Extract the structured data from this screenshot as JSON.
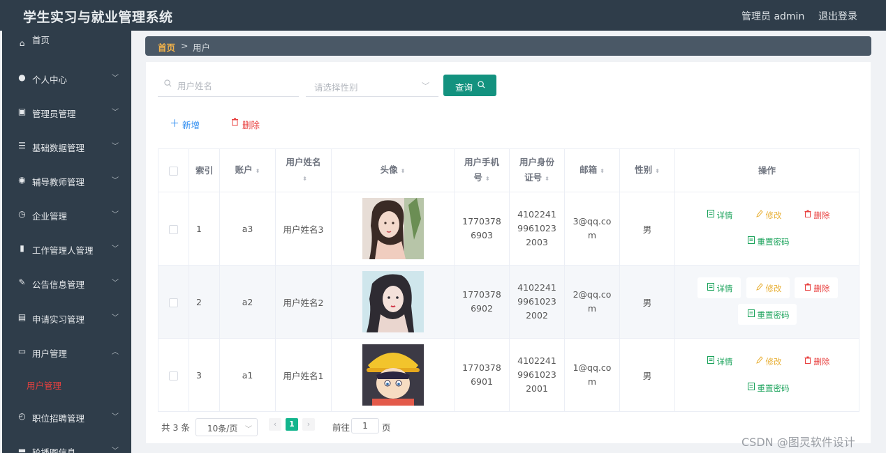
{
  "app": {
    "title": "学生实习与就业管理系统",
    "user_label": "管理员 admin",
    "logout_label": "退出登录"
  },
  "sidebar": {
    "items": [
      {
        "label": "首页",
        "icon": "home-icon",
        "glyph": "⌂"
      },
      {
        "label": "个人中心",
        "icon": "person-icon",
        "glyph": "●",
        "arrow": "﹀"
      },
      {
        "label": "管理员管理",
        "icon": "clipboard-icon",
        "glyph": "▣",
        "arrow": "﹀"
      },
      {
        "label": "基础数据管理",
        "icon": "list-icon",
        "glyph": "☰",
        "arrow": "﹀"
      },
      {
        "label": "辅导教师管理",
        "icon": "bulb-icon",
        "glyph": "◉",
        "arrow": "﹀"
      },
      {
        "label": "企业管理",
        "icon": "compass-icon",
        "glyph": "◷",
        "arrow": "﹀"
      },
      {
        "label": "工作管理人管理",
        "icon": "bar-chart-icon",
        "glyph": "▮",
        "arrow": "﹀"
      },
      {
        "label": "公告信息管理",
        "icon": "thumb-icon",
        "glyph": "✎",
        "arrow": "﹀"
      },
      {
        "label": "申请实习管理",
        "icon": "document-icon",
        "glyph": "▤",
        "arrow": "﹀"
      },
      {
        "label": "用户管理",
        "icon": "chat-icon",
        "glyph": "▭",
        "arrow": "︿"
      },
      {
        "label": "职位招聘管理",
        "icon": "clock-icon",
        "glyph": "◴",
        "arrow": "﹀"
      },
      {
        "label": "轮播图信息",
        "icon": "monitor-icon",
        "glyph": "▬",
        "arrow": "﹀"
      }
    ],
    "sub_active": "用户管理"
  },
  "breadcrumb": {
    "home": "首页",
    "separator": ">",
    "current": "用户"
  },
  "search": {
    "name_placeholder": "用户姓名",
    "gender_placeholder": "请选择性别",
    "query_label": "查询"
  },
  "actions": {
    "add_label": "新增",
    "delete_label": "删除"
  },
  "table": {
    "headers": {
      "index": "索引",
      "account": "账户",
      "name": "用户姓名",
      "avatar": "头像",
      "phone": "用户手机号",
      "idcard": "用户身份证号",
      "email": "邮箱",
      "gender": "性别",
      "ops": "操作"
    },
    "rows": [
      {
        "index": "1",
        "account": "a3",
        "name": "用户姓名3",
        "phone": "17703786903",
        "idcard": "410224199610232003",
        "email": "3@qq.com",
        "gender": "男"
      },
      {
        "index": "2",
        "account": "a2",
        "name": "用户姓名2",
        "phone": "17703786902",
        "idcard": "410224199610232002",
        "email": "2@qq.com",
        "gender": "男"
      },
      {
        "index": "3",
        "account": "a1",
        "name": "用户姓名1",
        "phone": "17703786901",
        "idcard": "410224199610232001",
        "email": "1@qq.com",
        "gender": "男"
      }
    ],
    "op_labels": {
      "detail": "详情",
      "edit": "修改",
      "remove": "删除",
      "reset": "重置密码"
    }
  },
  "pagination": {
    "total": "共 3 条",
    "page_size": "10条/页",
    "current_page": "1",
    "goto_label": "前往",
    "goto_value": "1",
    "page_suffix": "页"
  },
  "watermark": "CSDN @图灵软件设计",
  "colors": {
    "sidebar_bg": "#2f3d4a",
    "accent_teal": "#13927f",
    "danger": "#e8403f",
    "link_blue": "#2d8cf0",
    "success": "#19a25a",
    "warning": "#e8b037"
  }
}
